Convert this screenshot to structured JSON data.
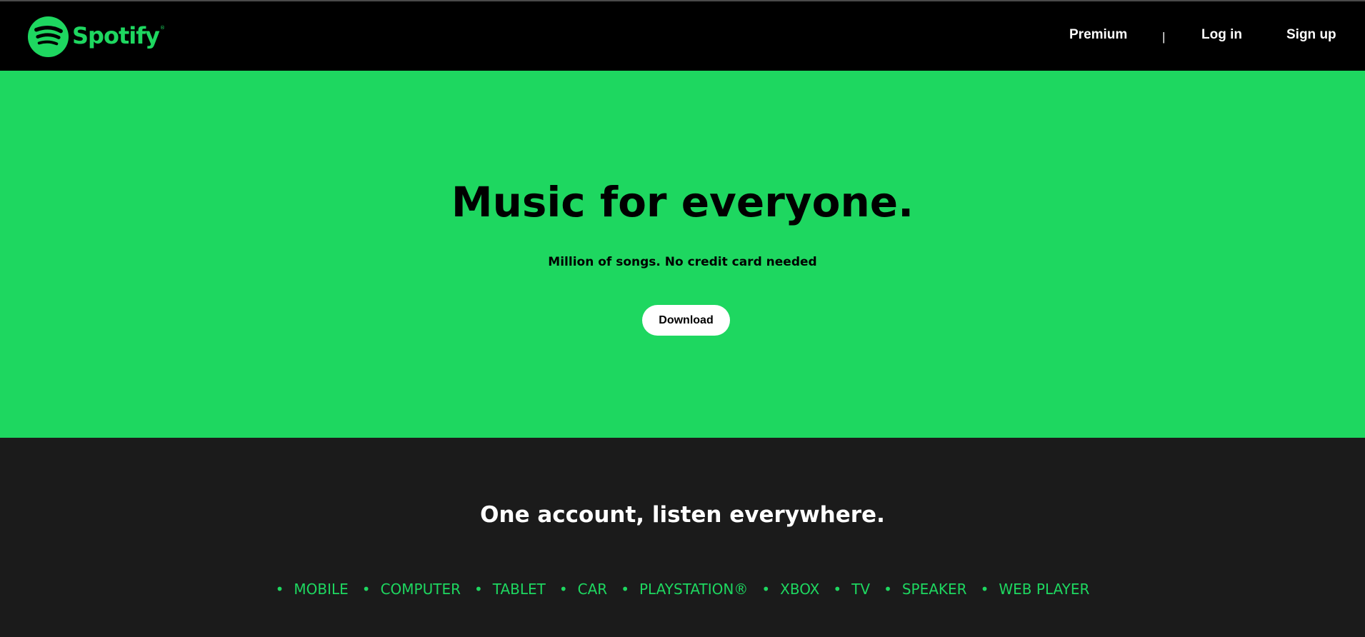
{
  "brand": {
    "name": "Spotify",
    "trademark": "®",
    "color": "#1ed760",
    "icon": "spotify-logo-icon"
  },
  "nav": {
    "premium": "Premium",
    "separator": "|",
    "login": "Log in",
    "signup": "Sign up"
  },
  "hero": {
    "title": "Music for everyone.",
    "subtitle": "Million of songs. No credit card needed",
    "download_label": "Download",
    "background": "#1ed760"
  },
  "devices": {
    "title": "One account, listen everywhere.",
    "bullet": "•",
    "items": [
      "MOBILE",
      "COMPUTER",
      "TABLET",
      "CAR",
      "PLAYSTATION®",
      "XBOX",
      "TV",
      "SPEAKER",
      "WEB PLAYER"
    ],
    "background": "#1b1b1b"
  }
}
